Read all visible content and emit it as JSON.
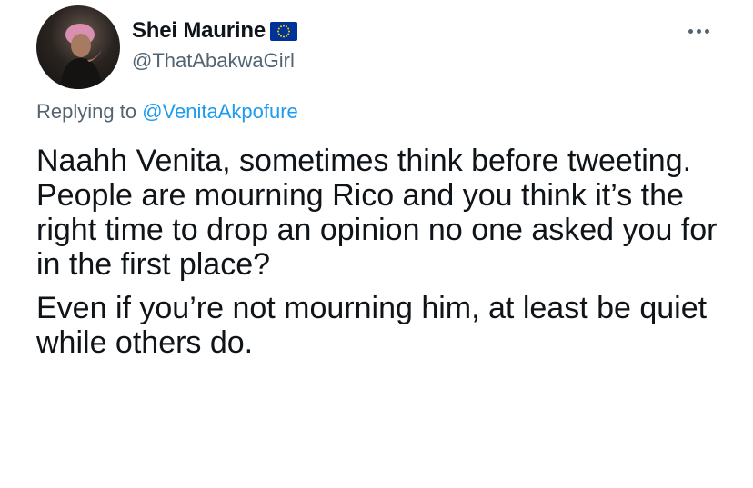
{
  "author": {
    "display_name": "Shei Maurine",
    "handle": "@ThatAbakwaGirl",
    "flag_icon": "eu-flag-icon"
  },
  "reply": {
    "prefix": "Replying to",
    "mention": "@VenitaAkpofure"
  },
  "tweet": {
    "paragraphs": [
      "Naahh Venita, sometimes think before tweeting.\nPeople are mourning Rico and you think it’s the right time to drop an opinion no one asked you for in the first place?",
      "Even if you’re not mourning him, at least be quiet while others do."
    ]
  },
  "colors": {
    "text": "#0f1419",
    "secondary": "#536471",
    "link": "#1d9bf0",
    "eu_blue": "#003399",
    "eu_gold": "#ffcc00"
  }
}
